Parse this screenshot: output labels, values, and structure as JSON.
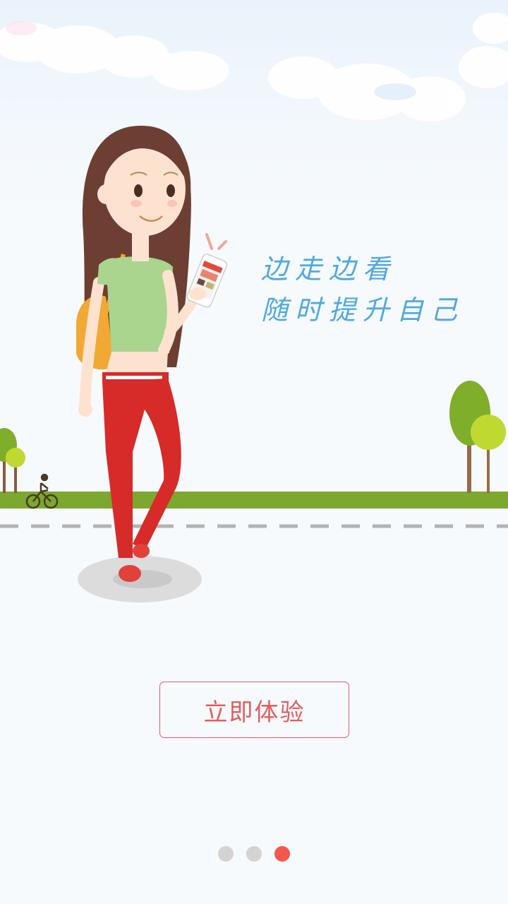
{
  "slogan": {
    "line1": "边走边看",
    "line2": "随时提升自己"
  },
  "cta": {
    "label": "立即体验"
  },
  "pager": {
    "total": 3,
    "active_index": 2
  },
  "colors": {
    "slogan": "#4fa8e0",
    "cta_border": "#e35d5d",
    "cta_text": "#e35d5d",
    "dot_inactive": "#d3d3d3",
    "dot_active": "#f4574c",
    "grass": "#7ba82e",
    "road_dash": "#b3b3b3"
  }
}
